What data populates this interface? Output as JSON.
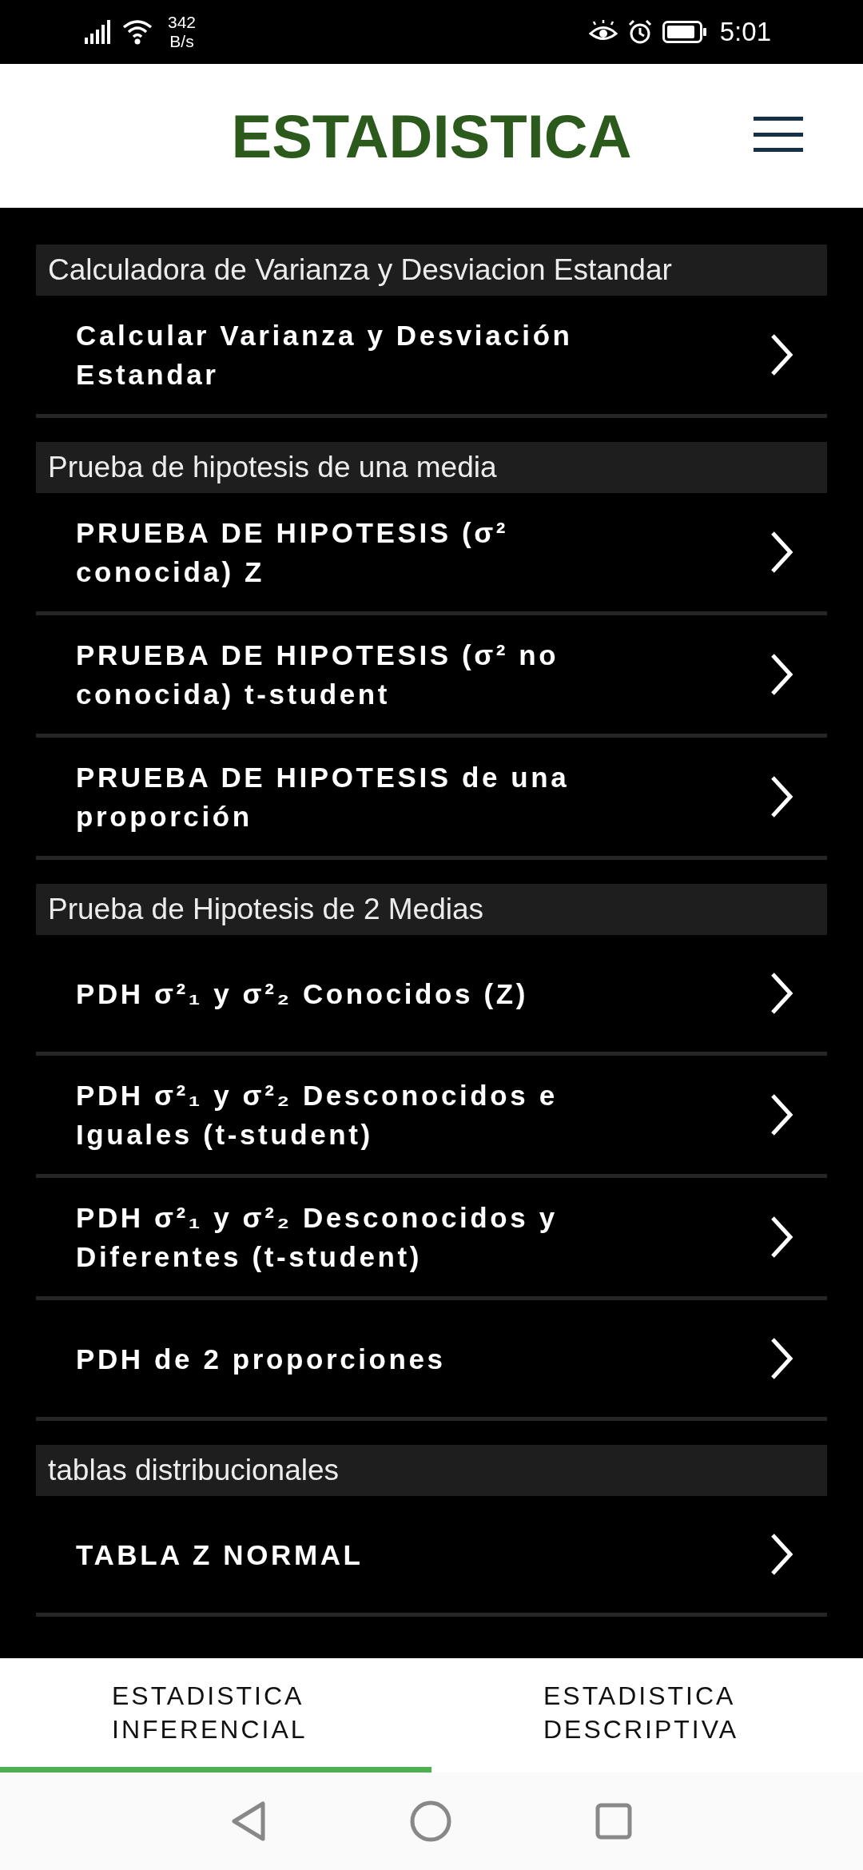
{
  "status_bar": {
    "speed": "342",
    "speed_unit": "B/s",
    "time": "5:01"
  },
  "header": {
    "title": "ESTADISTICA"
  },
  "sections": [
    {
      "title": "Calculadora de Varianza y Desviacion Estandar",
      "items": [
        {
          "label": "Calcular Varianza y Desviación Estandar"
        }
      ]
    },
    {
      "title": "Prueba de hipotesis de una media",
      "items": [
        {
          "label": "PRUEBA DE HIPOTESIS (σ² conocida) Z"
        },
        {
          "label": "PRUEBA DE HIPOTESIS (σ² no conocida) t-student"
        },
        {
          "label": "PRUEBA DE HIPOTESIS de una proporción"
        }
      ]
    },
    {
      "title": "Prueba de Hipotesis de 2 Medias",
      "items": [
        {
          "label": "PDH σ²₁ y σ²₂ Conocidos (Z)"
        },
        {
          "label": "PDH σ²₁ y σ²₂ Desconocidos e Iguales (t-student)"
        },
        {
          "label": "PDH σ²₁ y σ²₂ Desconocidos y Diferentes (t-student)"
        },
        {
          "label": "PDH de 2 proporciones"
        }
      ]
    },
    {
      "title": "tablas distribucionales",
      "items": [
        {
          "label": "TABLA Z NORMAL"
        }
      ]
    }
  ],
  "tabs": [
    {
      "label": "ESTADISTICA INFERENCIAL",
      "selected": true
    },
    {
      "label": "ESTADISTICA DESCRIPTIVA",
      "selected": false
    }
  ]
}
